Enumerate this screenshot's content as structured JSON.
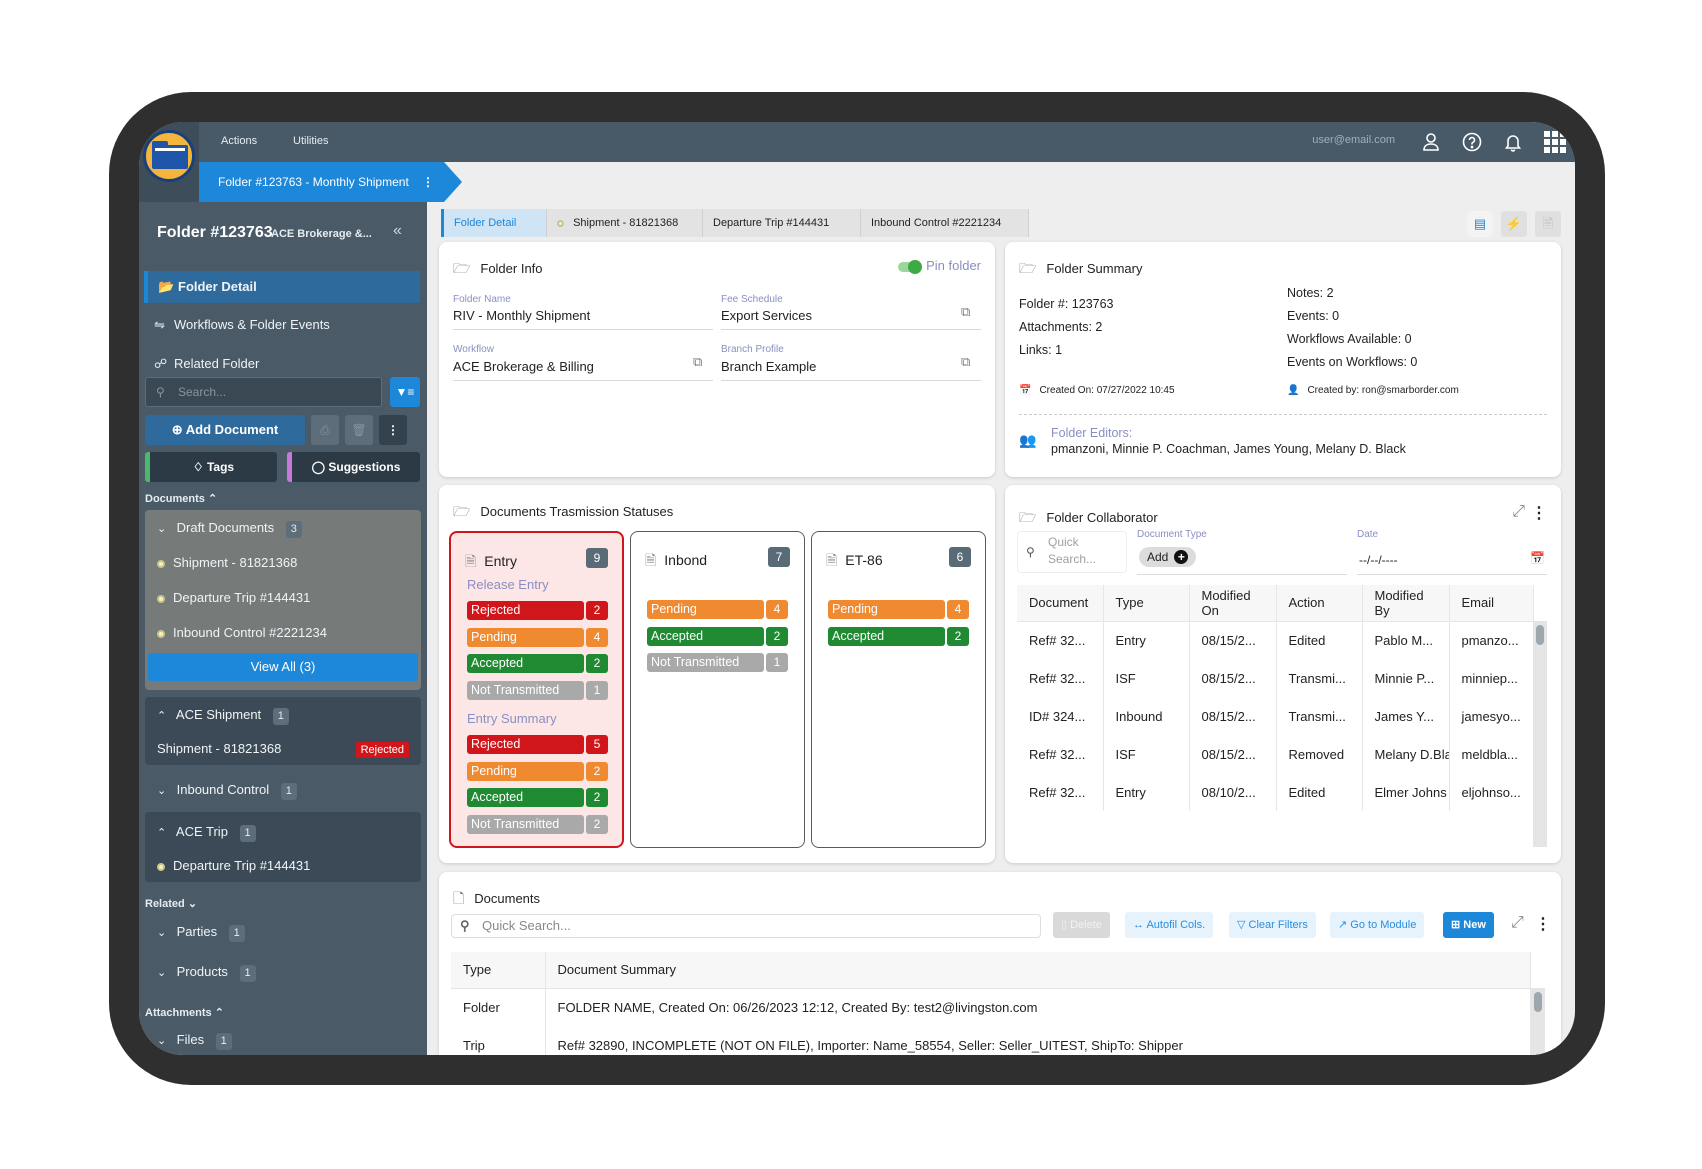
{
  "topbar": {
    "menu": [
      "Actions",
      "Utilities"
    ],
    "user_email": "user@email.com",
    "icons": [
      "user-icon",
      "help-icon",
      "bell-icon",
      "apps-grid-icon"
    ]
  },
  "breadcrumb": {
    "label": "Folder #123763 - Monthly Shipment"
  },
  "sidebar": {
    "title": "Folder #123763",
    "subtitle": "ACE Brokerage &...",
    "nav": [
      {
        "label": "Folder Detail",
        "icon": "folder-open-icon",
        "active": true
      },
      {
        "label": "Workflows & Folder Events",
        "icon": "workflow-icon",
        "active": false
      },
      {
        "label": "Related Folder",
        "icon": "related-icon",
        "active": false
      }
    ],
    "search_placeholder": "Search...",
    "add_document_label": "Add Document",
    "tags_label": "Tags",
    "suggestions_label": "Suggestions",
    "documents_label": "Documents",
    "draft": {
      "label": "Draft Documents",
      "count": "3",
      "items": [
        "Shipment - 81821368",
        "Departure Trip #144431",
        "Inbound Control #2221234"
      ],
      "view_all": "View All (3)"
    },
    "ace_shipment": {
      "label": "ACE Shipment",
      "count": "1",
      "item": "Shipment - 81821368",
      "status": "Rejected"
    },
    "inbound_control": {
      "label": "Inbound Control",
      "count": "1"
    },
    "ace_trip": {
      "label": "ACE Trip",
      "count": "1",
      "item": "Departure Trip #144431"
    },
    "related_label": "Related",
    "parties": {
      "label": "Parties",
      "count": "1"
    },
    "products": {
      "label": "Products",
      "count": "1"
    },
    "attachments_label": "Attachments",
    "files": {
      "label": "Files",
      "count": "1"
    }
  },
  "tabs": [
    {
      "label": "Folder Detail",
      "active": true
    },
    {
      "label": "Shipment - 81821368"
    },
    {
      "label": "Departure Trip #144431"
    },
    {
      "label": "Inbound Control #2221234"
    }
  ],
  "folder_info": {
    "title": "Folder Info",
    "pin_label": "Pin folder",
    "pinned": true,
    "fields": {
      "folder_name_label": "Folder Name",
      "folder_name": "RIV - Monthly Shipment",
      "fee_schedule_label": "Fee Schedule",
      "fee_schedule": "Export Services",
      "workflow_label": "Workflow",
      "workflow": "ACE Brokerage & Billing",
      "branch_profile_label": "Branch Profile",
      "branch_profile": "Branch Example"
    }
  },
  "folder_summary": {
    "title": "Folder Summary",
    "left": [
      "Folder #: 123763",
      "Attachments: 2",
      "Links: 1"
    ],
    "right": [
      "Notes: 2",
      "Events: 0",
      "Workflows Available: 0",
      "Events on Workflows: 0"
    ],
    "created_on": "Created On: 07/27/2022 10:45",
    "created_by": "Created by: ron@smarborder.com",
    "editors_label": "Folder Editors:",
    "editors": "pmanzoni, Minnie P. Coachman, James Young, Melany D. Black"
  },
  "transmission": {
    "title": "Documents Trasmission Statuses",
    "colors": {
      "Rejected": "#d0161b",
      "Pending": "#f08a31",
      "Accepted": "#1f8a32",
      "Not Transmitted": "#a9a9a9"
    },
    "boxes": [
      {
        "name": "Entry",
        "count": "9",
        "error": true,
        "groups": [
          {
            "label": "Release Entry",
            "rows": [
              [
                "Rejected",
                "2"
              ],
              [
                "Pending",
                "4"
              ],
              [
                "Accepted",
                "2"
              ],
              [
                "Not Transmitted",
                "1"
              ]
            ]
          },
          {
            "label": "Entry Summary",
            "rows": [
              [
                "Rejected",
                "5"
              ],
              [
                "Pending",
                "2"
              ],
              [
                "Accepted",
                "2"
              ],
              [
                "Not Transmitted",
                "2"
              ]
            ]
          }
        ]
      },
      {
        "name": "Inbond",
        "count": "7",
        "error": false,
        "groups": [
          {
            "label": "",
            "rows": [
              [
                "Pending",
                "4"
              ],
              [
                "Accepted",
                "2"
              ],
              [
                "Not Transmitted",
                "1"
              ]
            ]
          }
        ]
      },
      {
        "name": "ET-86",
        "count": "6",
        "error": false,
        "groups": [
          {
            "label": "",
            "rows": [
              [
                "Pending",
                "4"
              ],
              [
                "Accepted",
                "2"
              ]
            ]
          }
        ]
      }
    ]
  },
  "collaborator": {
    "title": "Folder Collaborator",
    "search_placeholder": "Quick Search...",
    "doc_type_label": "Document Type",
    "add_label": "Add",
    "date_label": "Date",
    "date_placeholder": "--/--/----",
    "columns": [
      "Document",
      "Type",
      "Modified On",
      "Action",
      "Modified By",
      "Email"
    ],
    "rows": [
      [
        "Ref# 32...",
        "Entry",
        "08/15/2...",
        "Edited",
        "Pablo M...",
        "pmanzo..."
      ],
      [
        "Ref# 32...",
        "ISF",
        "08/15/2...",
        "Transmi...",
        "Minnie P...",
        "minniep..."
      ],
      [
        "ID# 324...",
        "Inbound",
        "08/15/2...",
        "Transmi...",
        "James Y...",
        "jamesyo..."
      ],
      [
        "Ref# 32...",
        "ISF",
        "08/15/2...",
        "Removed",
        "Melany D.Bla",
        "meldbla..."
      ],
      [
        "Ref# 32...",
        "Entry",
        "08/10/2...",
        "Edited",
        "Elmer Johns",
        "eljohnso..."
      ]
    ]
  },
  "documents": {
    "title": "Documents",
    "search_placeholder": "Quick Search...",
    "buttons": {
      "delete": "Delete",
      "autofit": "Autofil Cols.",
      "clear_filters": "Clear Filters",
      "go_to_module": "Go to Module",
      "new": "New"
    },
    "columns": [
      "Type",
      "Document Summary"
    ],
    "rows": [
      [
        "Folder",
        "FOLDER NAME, Created On: 06/26/2023 12:12, Created By: test2@livingston.com"
      ],
      [
        "Trip",
        "Ref# 32890, INCOMPLETE (NOT ON FILE), Importer: Name_58554, Seller: Seller_UITEST, ShipTo: Shipper"
      ]
    ]
  }
}
